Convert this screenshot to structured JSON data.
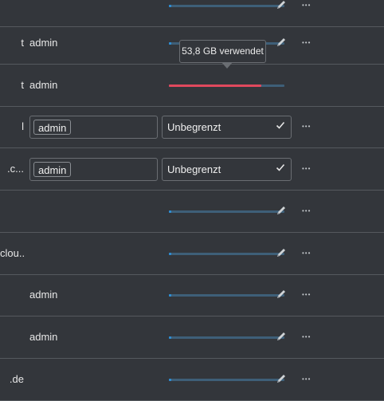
{
  "rows": [
    {
      "edge": "",
      "group": "",
      "usage": 0.02,
      "over": false
    },
    {
      "edge": "t",
      "group": "admin",
      "usage": 0.02,
      "over": false
    },
    {
      "edge": "t",
      "group": "admin",
      "usage": 0.8,
      "over": true,
      "tooltip": "53,8 GB verwendet"
    },
    {
      "edge": "l",
      "group": "admin",
      "quota": "Unbegrenzt",
      "editing": true
    },
    {
      "edge": ".c...",
      "group": "admin",
      "quota": "Unbegrenzt",
      "editing": true
    },
    {
      "edge": "",
      "group": "",
      "usage": 0.02,
      "over": false
    },
    {
      "edge": "clou...",
      "group": "",
      "usage": 0.02,
      "over": false
    },
    {
      "edge": "",
      "group": "admin",
      "usage": 0.02,
      "over": false
    },
    {
      "edge": "",
      "group": "admin",
      "usage": 0.02,
      "over": false
    },
    {
      "edge": ".de",
      "group": "",
      "usage": 0.02,
      "over": false
    }
  ],
  "icons": {
    "edit": "pencil-icon",
    "more": "more-horizontal-icon",
    "check": "check-icon"
  },
  "colors": {
    "background": "#33363b",
    "quota_bar": "#3e5f78",
    "quota_fill": "#2e8fd6",
    "over_quota": "#e0495d"
  }
}
